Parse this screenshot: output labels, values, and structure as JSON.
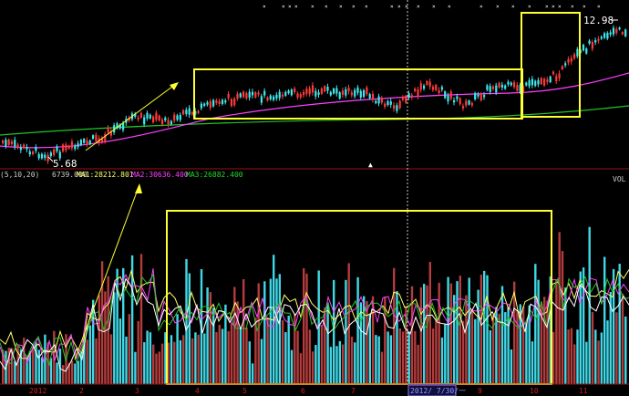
{
  "price_panel": {
    "high_label": "12.98",
    "low_label": "5.68",
    "up_marker": "▲"
  },
  "volume_panel": {
    "header_prefix": "(5,10,20)",
    "vol_value": "6739.000",
    "ma1_label": "MA1:28212.801",
    "ma2_label": "MA2:30636.400",
    "ma3_label": "MA3:26882.400",
    "right_label": "VOL"
  },
  "time_axis": {
    "labels": [
      "2012",
      "2",
      "3",
      "4",
      "5",
      "6",
      "7",
      "8",
      "9",
      "10",
      "11"
    ],
    "cursor_label": "2012/ 7/30/一"
  },
  "colors": {
    "up": "#ff3a3a",
    "down": "#3fe8ee",
    "ma_white": "#ffffff",
    "ma_magenta": "#ff40ff",
    "ma_green": "#22c42a",
    "highlight_box": "#ffff33",
    "axis_text": "#d12020",
    "cursor_label": "#8080ff",
    "volume_up": "#b43c3c",
    "volume_down": "#40d8e6"
  },
  "chart_data": {
    "type": "candlestick",
    "price_range_shown": [
      5.68,
      12.98
    ],
    "annotations": [
      "12.98",
      "5.68"
    ],
    "x_tick_labels": [
      "2012",
      "2",
      "3",
      "4",
      "5",
      "6",
      "7",
      "8",
      "9",
      "10",
      "11"
    ]
  }
}
